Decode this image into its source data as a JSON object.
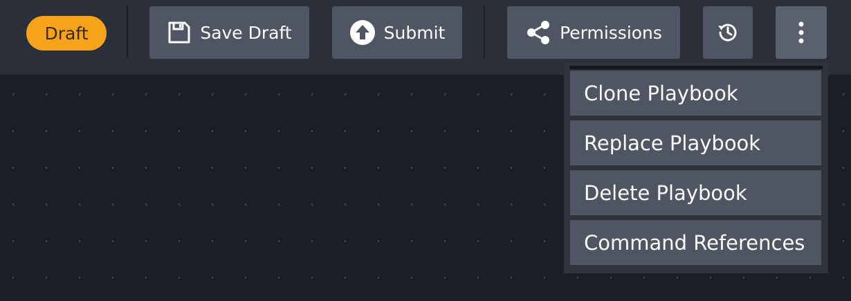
{
  "status": {
    "badge_label": "Draft",
    "badge_color": "#f6a21a"
  },
  "toolbar": {
    "save_draft_label": "Save Draft",
    "submit_label": "Submit",
    "permissions_label": "Permissions",
    "history_icon": "history-icon",
    "more_icon": "more-vertical-icon"
  },
  "menu": {
    "items": [
      {
        "label": "Clone Playbook"
      },
      {
        "label": "Replace Playbook"
      },
      {
        "label": "Delete Playbook"
      },
      {
        "label": "Command References"
      }
    ]
  },
  "colors": {
    "toolbar_bg": "#2b2f38",
    "button_bg": "#4f5562",
    "canvas_bg": "#1c1f27"
  }
}
